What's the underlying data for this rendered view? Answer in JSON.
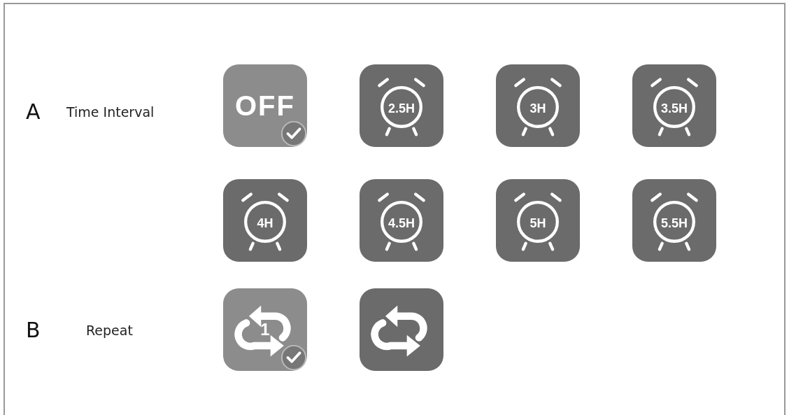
{
  "sections": [
    {
      "letter": "A",
      "label": "Time Interval",
      "rows": [
        [
          {
            "kind": "off",
            "text": "OFF",
            "selected": true
          },
          {
            "kind": "alarm",
            "text": "2.5H",
            "selected": false
          },
          {
            "kind": "alarm",
            "text": "3H",
            "selected": false
          },
          {
            "kind": "alarm",
            "text": "3.5H",
            "selected": false
          }
        ],
        [
          {
            "kind": "alarm",
            "text": "4H",
            "selected": false
          },
          {
            "kind": "alarm",
            "text": "4.5H",
            "selected": false
          },
          {
            "kind": "alarm",
            "text": "5H",
            "selected": false
          },
          {
            "kind": "alarm",
            "text": "5.5H",
            "selected": false
          }
        ]
      ]
    },
    {
      "letter": "B",
      "label": "Repeat",
      "rows": [
        [
          {
            "kind": "repeat-one",
            "text": "1",
            "selected": true
          },
          {
            "kind": "repeat",
            "selected": false
          }
        ]
      ]
    }
  ]
}
